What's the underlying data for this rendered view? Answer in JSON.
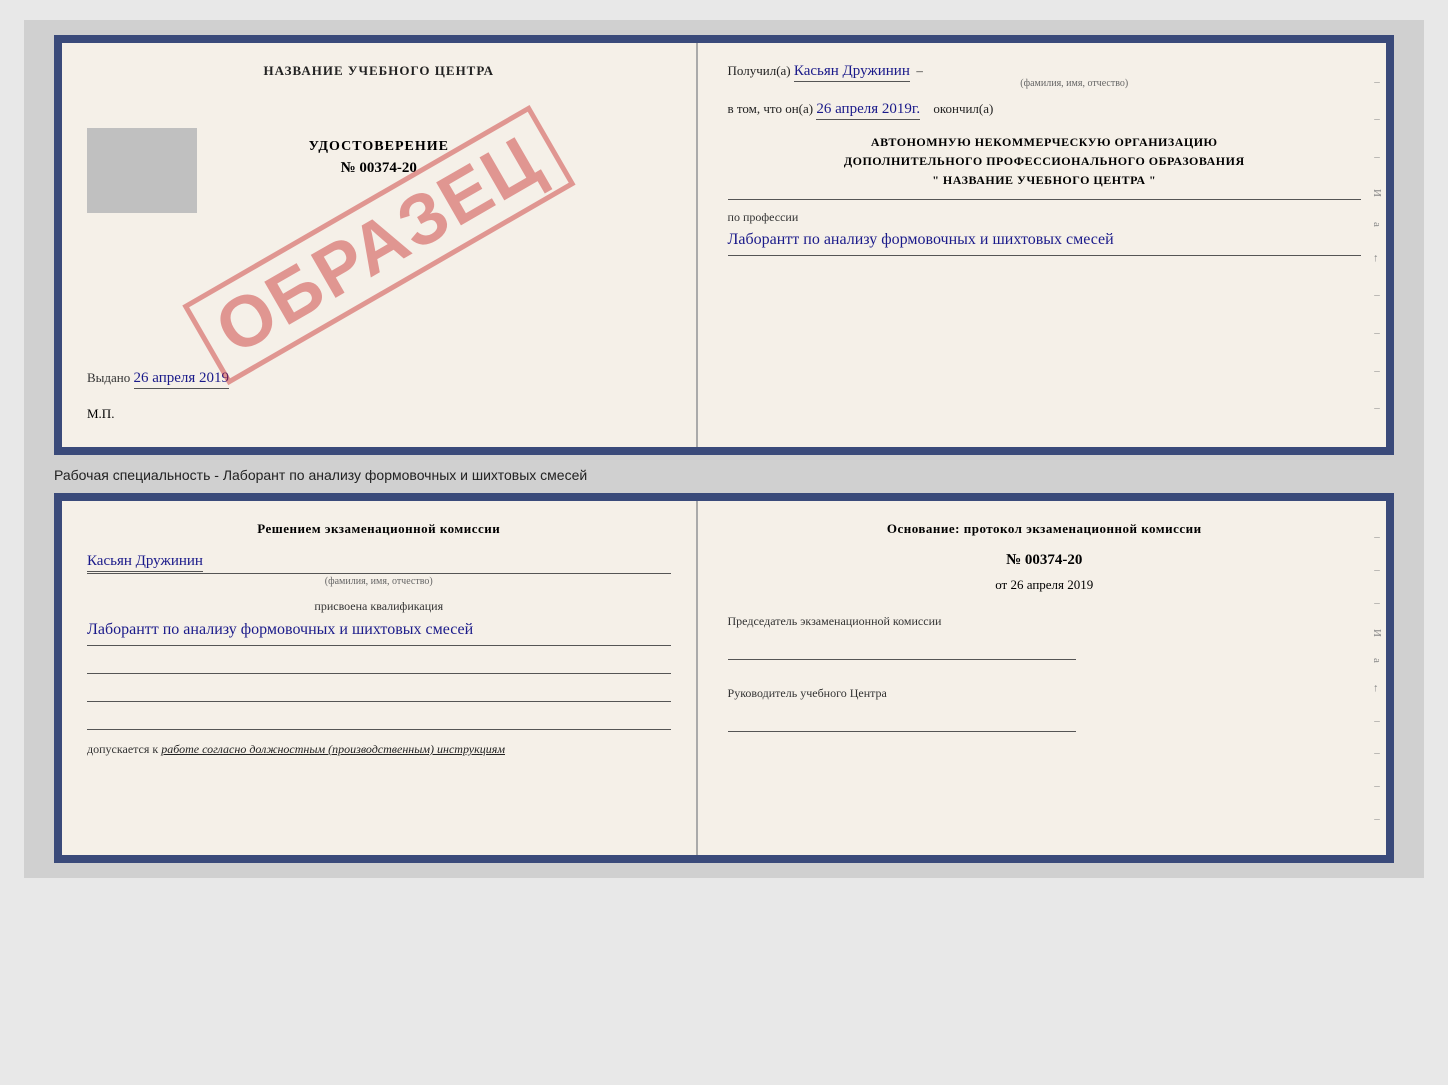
{
  "top_document": {
    "left": {
      "center_title": "НАЗВАНИЕ УЧЕБНОГО ЦЕНТРА",
      "stamp_text": "ОБРАЗЕЦ",
      "udostoverenie_label": "УДОСТОВЕРЕНИЕ",
      "doc_number": "№ 00374-20",
      "vidano_label": "Выдано",
      "vidano_date": "26 апреля 2019",
      "mp_label": "М.П."
    },
    "right": {
      "poluchil_label": "Получил(а)",
      "poluchil_name": "Касьян Дружинин",
      "fio_sublabel": "(фамилия, имя, отчество)",
      "vtom_label": "в том, что он(а)",
      "date_value": "26 апреля 2019г.",
      "okoncil_label": "окончил(а)",
      "org_line1": "АВТОНОМНУЮ НЕКОММЕРЧЕСКУЮ ОРГАНИЗАЦИЮ",
      "org_line2": "ДОПОЛНИТЕЛЬНОГО ПРОФЕССИОНАЛЬНОГО ОБРАЗОВАНИЯ",
      "org_line3": "\"  НАЗВАНИЕ УЧЕБНОГО ЦЕНТРА  \"",
      "po_professii_label": "по профессии",
      "profession_value": "Лаборантт по анализу формовочных и шихтовых смесей"
    }
  },
  "subtitle": "Рабочая специальность - Лаборант по анализу формовочных и шихтовых смесей",
  "bottom_document": {
    "left": {
      "komissia_title": "Решением экзаменационной комиссии",
      "name_value": "Касьян Дружинин",
      "fio_sublabel": "(фамилия, имя, отчество)",
      "kvalifikaciya_label": "присвоена квалификация",
      "kvalifikaciya_value": "Лаборантт по анализу формовочных и шихтовых смесей",
      "dopuskaetsya_label": "допускается к",
      "dopuskaetsya_value": "работе согласно должностным (производственным) инструкциям"
    },
    "right": {
      "osnovanie_title": "Основание: протокол экзаменационной комиссии",
      "protocol_number": "№ 00374-20",
      "protocol_date_prefix": "от",
      "protocol_date": "26 апреля 2019",
      "predsedatel_label": "Председатель экзаменационной комиссии",
      "rukovoditel_label": "Руководитель учебного Центра"
    }
  },
  "side_marks": {
    "dash": "–",
    "i_mark": "И",
    "a_mark": "а",
    "arrow_mark": "←"
  }
}
